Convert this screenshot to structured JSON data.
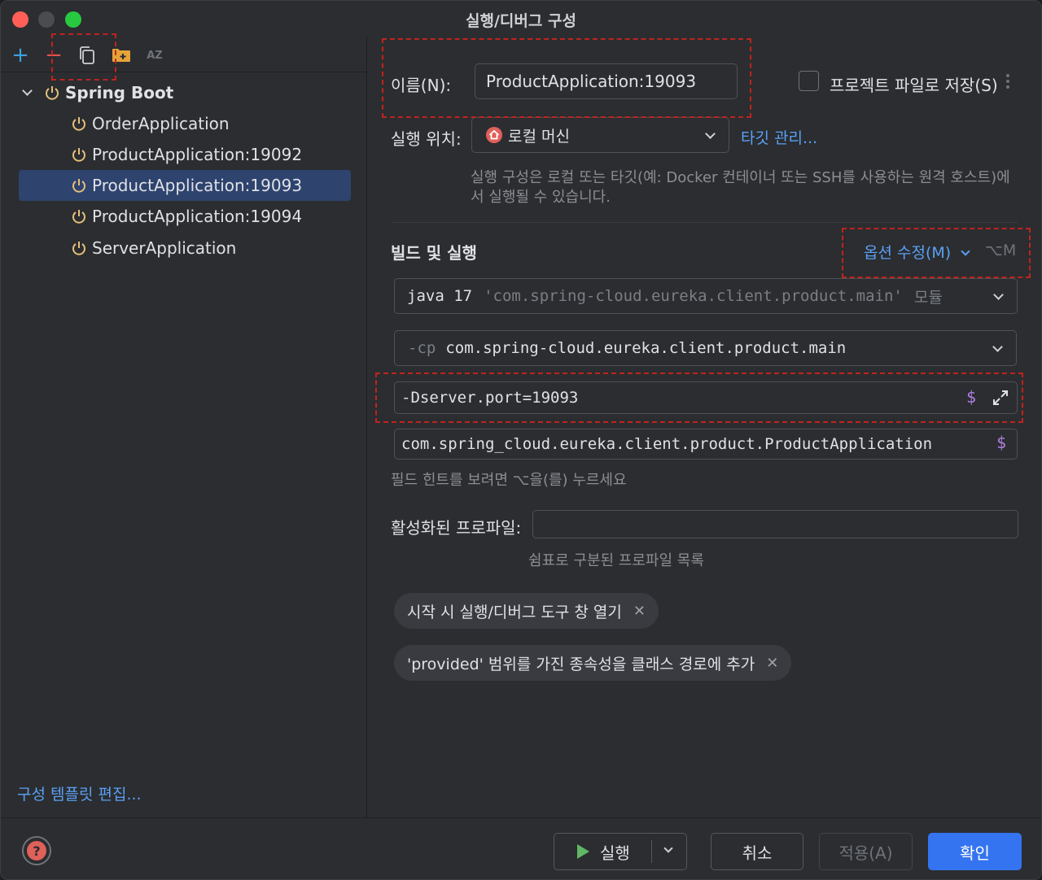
{
  "window": {
    "title": "실행/디버그 구성"
  },
  "toolbar": {
    "add": "+",
    "remove": "−",
    "sort": "AZ"
  },
  "tree": {
    "group": "Spring Boot",
    "items": [
      {
        "label": "OrderApplication"
      },
      {
        "label": "ProductApplication:19092"
      },
      {
        "label": "ProductApplication:19093"
      },
      {
        "label": "ProductApplication:19094"
      },
      {
        "label": "ServerApplication"
      }
    ]
  },
  "sidebar": {
    "edit_templates": "구성 템플릿 편집..."
  },
  "form": {
    "name_label": "이름(N):",
    "name_value": "ProductApplication:19093",
    "store_label": "프로젝트 파일로 저장(S)",
    "run_on_label": "실행 위치:",
    "run_on_value": "로컬 머신",
    "manage_targets": "타깃 관리...",
    "run_on_hint_1": "실행 구성은 로컬 또는 타깃(예: Docker 컨테이너 또는 SSH를 사용하는 원격 호스트)에",
    "run_on_hint_2": "서 실행될 수 있습니다.",
    "build_run_title": "빌드 및 실행",
    "modify_options": "옵션 수정(M)",
    "modify_shortcut": "⌥M",
    "jre_java": "java 17",
    "jre_module": "'com.spring-cloud.eureka.client.product.main'",
    "jre_suffix": "모듈",
    "cp_prefix": "-cp",
    "cp_value": "com.spring-cloud.eureka.client.product.main",
    "vm_options": "-Dserver.port=19093",
    "main_class": "com.spring_cloud.eureka.client.product.ProductApplication",
    "field_hint": "필드 힌트를 보려면 ⌥을(를) 누르세요",
    "profiles_label": "활성화된 프로파일:",
    "profiles_value": "",
    "profiles_hint": "쉼표로 구분된 프로파일 목록",
    "chips": [
      {
        "label": "시작 시 실행/디버그 도구 창 열기"
      },
      {
        "label": "'provided' 범위를 가진 종속성을 클래스 경로에 추가"
      }
    ],
    "dollar": "$"
  },
  "footer": {
    "run": "실행",
    "cancel": "취소",
    "apply": "적용(A)",
    "ok": "확인",
    "help": "?"
  },
  "colors": {
    "accent": "#3574f0",
    "link": "#5ba0f5",
    "run_icon": "#e5c07b",
    "annotation": "#c0231e"
  }
}
